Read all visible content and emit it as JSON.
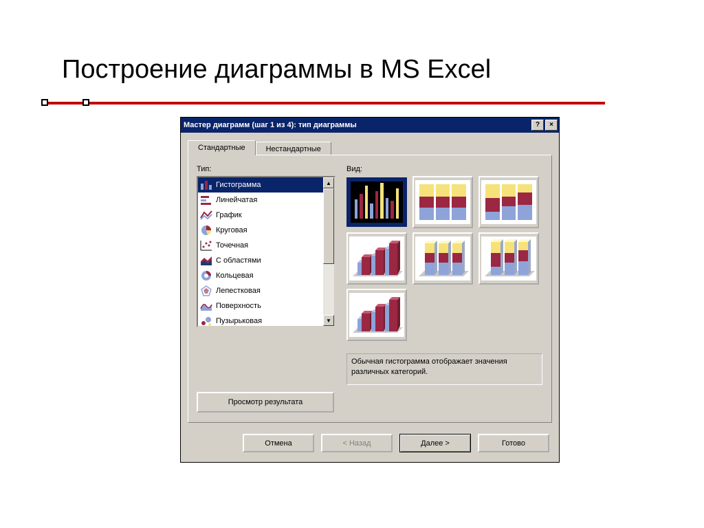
{
  "slide": {
    "title": "Построение диаграммы в MS Excel"
  },
  "dialog": {
    "title": "Мастер диаграмм (шаг 1 из 4): тип диаграммы",
    "help_btn": "?",
    "close_btn": "×",
    "tabs": {
      "standard": "Стандартные",
      "custom": "Нестандартные"
    },
    "labels": {
      "type": "Тип:",
      "view": "Вид:"
    },
    "type_list": [
      {
        "name": "Гистограмма",
        "icon": "column-icon",
        "selected": true
      },
      {
        "name": "Линейчатая",
        "icon": "bar-icon"
      },
      {
        "name": "График",
        "icon": "line-icon"
      },
      {
        "name": "Круговая",
        "icon": "pie-icon"
      },
      {
        "name": "Точечная",
        "icon": "scatter-icon"
      },
      {
        "name": "С областями",
        "icon": "area-icon"
      },
      {
        "name": "Кольцевая",
        "icon": "doughnut-icon"
      },
      {
        "name": "Лепестковая",
        "icon": "radar-icon"
      },
      {
        "name": "Поверхность",
        "icon": "surface-icon"
      },
      {
        "name": "Пузырьковая",
        "icon": "bubble-icon"
      }
    ],
    "subtype_count": 7,
    "subtype_selected": 0,
    "description": "Обычная гистограмма отображает значения различных категорий.",
    "preview_btn": "Просмотр результата",
    "buttons": {
      "cancel": "Отмена",
      "back": "< Назад",
      "next": "Далее >",
      "finish": "Готово"
    }
  }
}
